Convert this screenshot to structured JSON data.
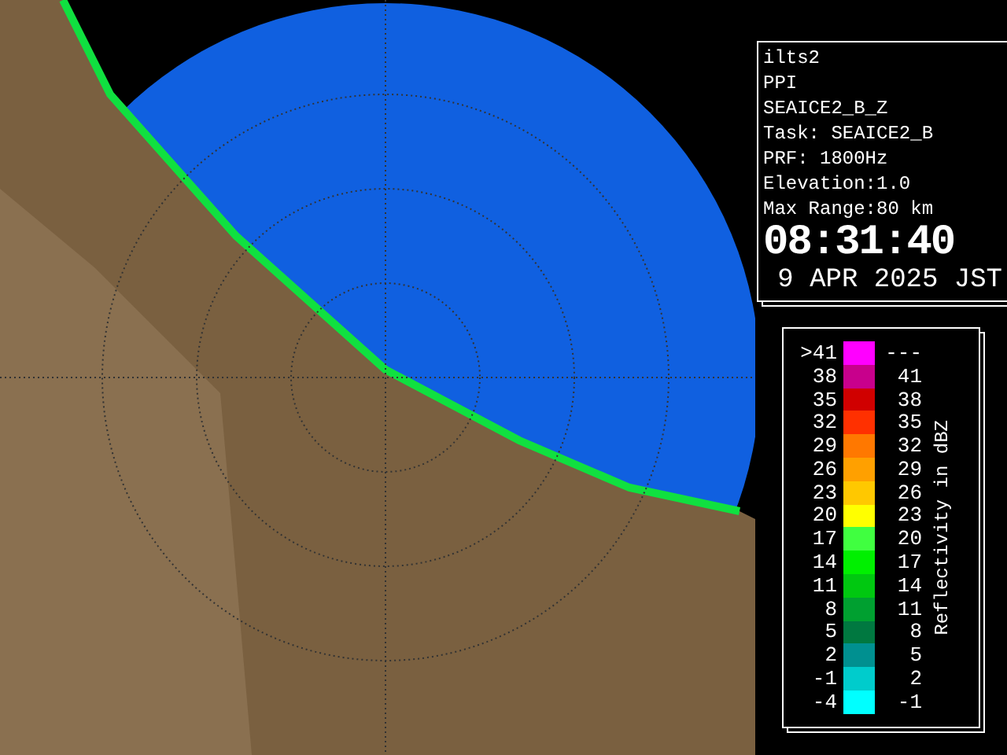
{
  "info": {
    "lines": [
      "ilts2",
      "PPI",
      "SEAICE2_B_Z",
      "Task: SEAICE2_B",
      "PRF: 1800Hz",
      "Elevation:1.0",
      "Max Range:80 km"
    ],
    "time": "08:31:40",
    "date": "9 APR 2025 JST"
  },
  "legend": {
    "title": "Reflectivity in dBZ",
    "rows": [
      {
        "lower": ">41",
        "upper": "---",
        "color": "#ff00ff"
      },
      {
        "lower": "38",
        "upper": "41",
        "color": "#c8008c"
      },
      {
        "lower": "35",
        "upper": "38",
        "color": "#d00000"
      },
      {
        "lower": "32",
        "upper": "35",
        "color": "#ff3000"
      },
      {
        "lower": "29",
        "upper": "32",
        "color": "#ff7800"
      },
      {
        "lower": "26",
        "upper": "29",
        "color": "#ffa000"
      },
      {
        "lower": "23",
        "upper": "26",
        "color": "#ffc800"
      },
      {
        "lower": "20",
        "upper": "23",
        "color": "#ffff00"
      },
      {
        "lower": "17",
        "upper": "20",
        "color": "#40ff40"
      },
      {
        "lower": "14",
        "upper": "17",
        "color": "#00f000"
      },
      {
        "lower": "11",
        "upper": "14",
        "color": "#00c810"
      },
      {
        "lower": "8",
        "upper": "11",
        "color": "#00a030"
      },
      {
        "lower": "5",
        "upper": "8",
        "color": "#007840"
      },
      {
        "lower": "2",
        "upper": "5",
        "color": "#009090"
      },
      {
        "lower": "-1",
        "upper": "2",
        "color": "#00cccc"
      },
      {
        "lower": "-4",
        "upper": "-1",
        "color": "#00ffff"
      }
    ]
  }
}
